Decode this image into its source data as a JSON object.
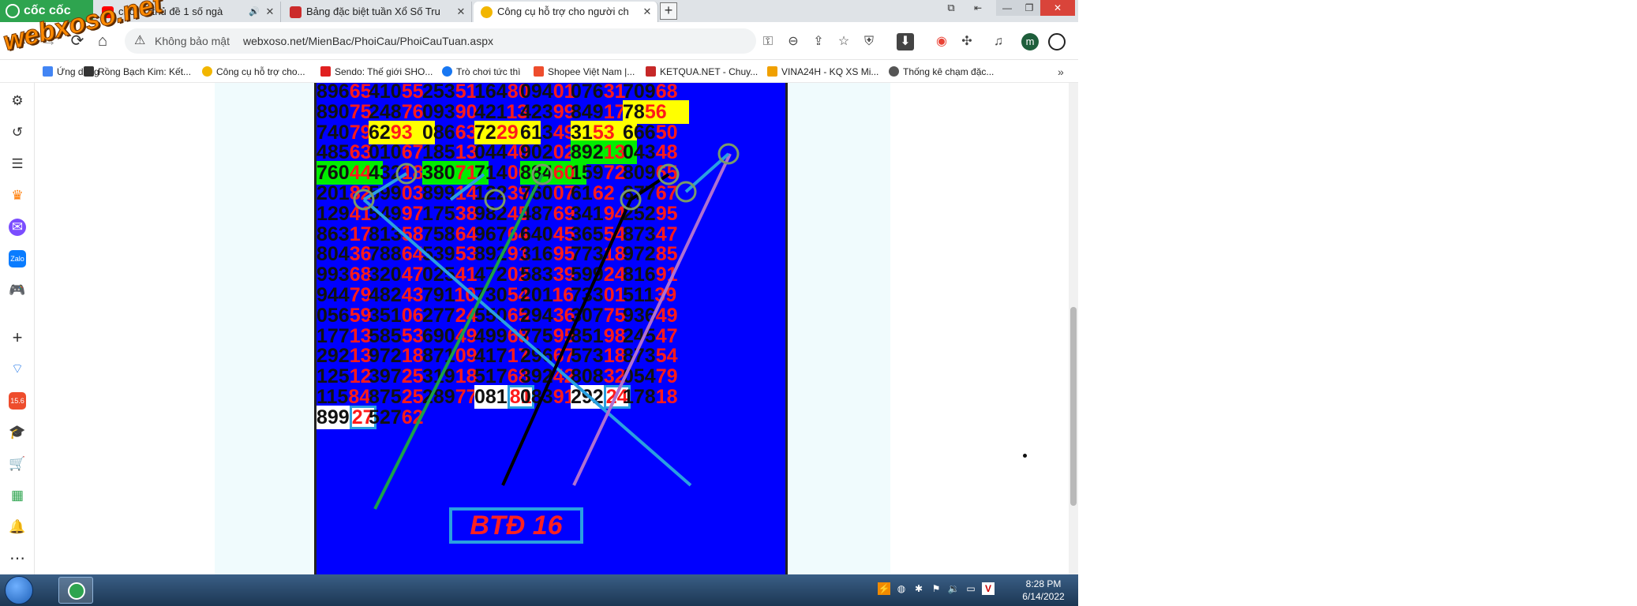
{
  "browser": {
    "brand_name": "cốc cốc",
    "tabs": [
      {
        "title": "chốt ... thủ đề 1 số ngà",
        "favicon": "youtube-icon",
        "favicon_color": "#ff0000",
        "audio": "🔊",
        "active": false
      },
      {
        "title": "Bảng đặc biệt tuần Xổ Số Tru",
        "favicon": "xoso-icon",
        "favicon_color": "#cc2b2b",
        "active": false
      },
      {
        "title": "Công cụ hỗ trợ cho người ch",
        "favicon": "xs-icon",
        "favicon_color": "#f2b600",
        "active": true
      }
    ],
    "close_label": "✕",
    "new_tab_label": "+",
    "window_controls": {
      "minimize": "—",
      "maximize": "❐",
      "close": "✕"
    },
    "address": {
      "security_label": "Không bảo mật",
      "url": "webxoso.net/MienBac/PhoiCau/PhoiCauTuan.aspx"
    },
    "profile_initial": "m",
    "bookmarks": [
      {
        "label": "Ứng dụng",
        "color": "#4285f4"
      },
      {
        "label": "Rồng Bạch Kim: Kết...",
        "color": "#333333"
      },
      {
        "label": "Công cụ hỗ trợ cho...",
        "color": "#f2b600"
      },
      {
        "label": "Sendo: Thế giới SHO...",
        "color": "#e02020"
      },
      {
        "label": "Trò chơi tức thì",
        "color": "#1877f2"
      },
      {
        "label": "Shopee Việt Nam |...",
        "color": "#ee4d2d"
      },
      {
        "label": "KETQUA.NET - Chuy...",
        "color": "#c62828"
      },
      {
        "label": "VINA24H - KQ XS Mi...",
        "color": "#f0a000"
      },
      {
        "label": "Thống kê chạm đặc...",
        "color": "#555555"
      }
    ],
    "bookmarks_more": "»"
  },
  "watermark": "webxoso.net",
  "board": {
    "rows": [
      [
        "896|65",
        "410|55",
        "253|51",
        "164|80",
        "094|01",
        "076|31",
        "709|68"
      ],
      [
        "890|75",
        "248|76",
        "093|90",
        "421|13",
        "423|99",
        "849|17",
        "78|56"
      ],
      [
        "740|79",
        "62|93",
        "086|63",
        "72|29",
        "613|49",
        "31|53",
        "666|50"
      ],
      [
        "485|63",
        "010|67",
        "185|13",
        "044|40",
        "902|02",
        "892|13",
        "043|48"
      ],
      [
        "760|44",
        "432|18",
        "380|71",
        "714|00",
        "884|60",
        "159|72",
        "809|65"
      ],
      [
        "201|82",
        "599|03",
        "899|14",
        "122|39",
        "760|07",
        "61|62",
        "877|67"
      ],
      [
        "129|41",
        "549|97",
        "175|38",
        "982|45",
        "487|69",
        "341|94",
        "252|95"
      ],
      [
        "863|17",
        "813|58",
        "758|64",
        "967|64",
        "640|45",
        "365|54",
        "873|47"
      ],
      [
        "804|36",
        "788|64",
        "539|53",
        "892|91",
        "316|95",
        "773|18",
        "972|85"
      ],
      [
        "993|68",
        "320|47",
        "025|41",
        "472|02",
        "583|39",
        "599|24",
        "816|91"
      ],
      [
        "944|79",
        "482|43",
        "791|10",
        "730|54",
        "201|16",
        "733|01",
        "511|39"
      ],
      [
        "056|59",
        "351|06",
        "277|24",
        "550|65",
        "294|36",
        "307|75",
        "936|49"
      ],
      [
        "177|13",
        "585|53",
        "690|49",
        "499|68",
        "775|95",
        "851|98",
        "245|47"
      ],
      [
        "292|13",
        "972|18",
        "871|09",
        "417|17",
        "296|67",
        "573|18",
        "873|54"
      ],
      [
        "125|12",
        "397|25",
        "319|18",
        "517|68",
        "392|42",
        "808|32",
        "054|79"
      ],
      [
        "115|84",
        "875|25",
        "289|77",
        "081|81",
        "083|91",
        "292|24",
        "178|18"
      ],
      [
        "899|27",
        "527|62",
        "",
        "",
        "",
        "",
        ""
      ]
    ],
    "highlights": [
      {
        "row": 1,
        "col": 6,
        "type": "yellow"
      },
      {
        "row": 2,
        "col": 1,
        "type": "yellow"
      },
      {
        "row": 2,
        "col": 3,
        "type": "yellow"
      },
      {
        "row": 2,
        "col": 5,
        "type": "yellow"
      },
      {
        "row": 3,
        "col": 5,
        "type": "green"
      },
      {
        "row": 4,
        "col": 0,
        "type": "green"
      },
      {
        "row": 4,
        "col": 2,
        "type": "green"
      },
      {
        "row": 4,
        "col": 4,
        "type": "green"
      },
      {
        "row": 15,
        "col": 3,
        "type": "white-box"
      },
      {
        "row": 15,
        "col": 5,
        "type": "white-box"
      },
      {
        "row": 16,
        "col": 0,
        "type": "white-box"
      }
    ],
    "banner": "BTĐ 16",
    "line_colors": {
      "cyan": "#2aa0e0",
      "green": "#1aa04a",
      "black": "#000000",
      "purple": "#b070d0",
      "ring": "#7a9a6a"
    }
  },
  "taskbar": {
    "time": "8:28 PM",
    "date": "6/14/2022"
  }
}
